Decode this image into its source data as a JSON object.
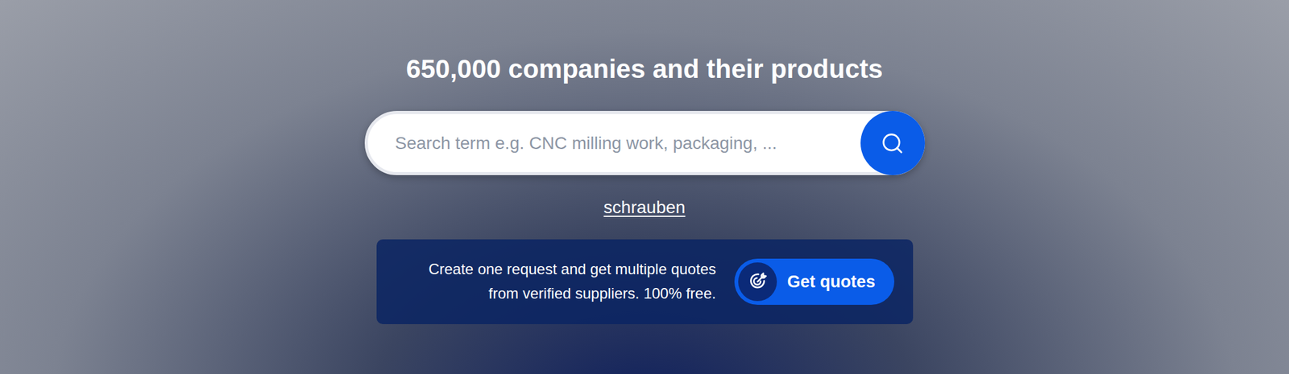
{
  "hero": {
    "title": "650,000 companies and their products"
  },
  "search": {
    "placeholder": "Search term e.g. CNC milling work, packaging, ..."
  },
  "suggestions": [
    {
      "label": "schrauben"
    }
  ],
  "quote_panel": {
    "lines": [
      "Create one request and get multiple quotes",
      "from verified suppliers. 100% free."
    ],
    "button": "Get quotes"
  }
}
